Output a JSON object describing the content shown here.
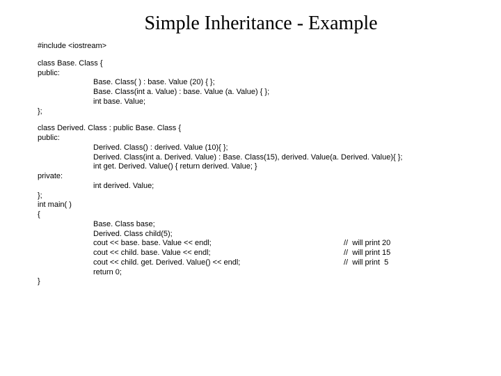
{
  "title": "Simple Inheritance - Example",
  "code": {
    "l1": "#include <iostream>",
    "l2": "class Base. Class {",
    "l3": "public:",
    "l4": "Base. Class( ) : base. Value (20) { };",
    "l5": "Base. Class(int a. Value) : base. Value (a. Value) { };",
    "l6": "int base. Value;",
    "l7": "};",
    "l8": "class Derived. Class : public Base. Class {",
    "l9": "public:",
    "l10": "Derived. Class() : derived. Value (10){ };",
    "l11": "Derived. Class(int a. Derived. Value) : Base. Class(15), derived. Value(a. Derived. Value){ };",
    "l12": "int get. Derived. Value() { return derived. Value; }",
    "l13": "private:",
    "l14": "int derived. Value;",
    "l15": "};",
    "l16": "int main( )",
    "l17": "{",
    "l18": "Base. Class base;",
    "l19": "Derived. Class child(5);",
    "m1l": "cout << base. base. Value << endl;",
    "m1r": "//  will print 20",
    "m2l": "cout << child. base. Value << endl;",
    "m2r": "//  will print 15",
    "m3l": "cout << child. get. Derived. Value() << endl;",
    "m3r": "//  will print  5",
    "l20": "return 0;",
    "l21": "}"
  }
}
